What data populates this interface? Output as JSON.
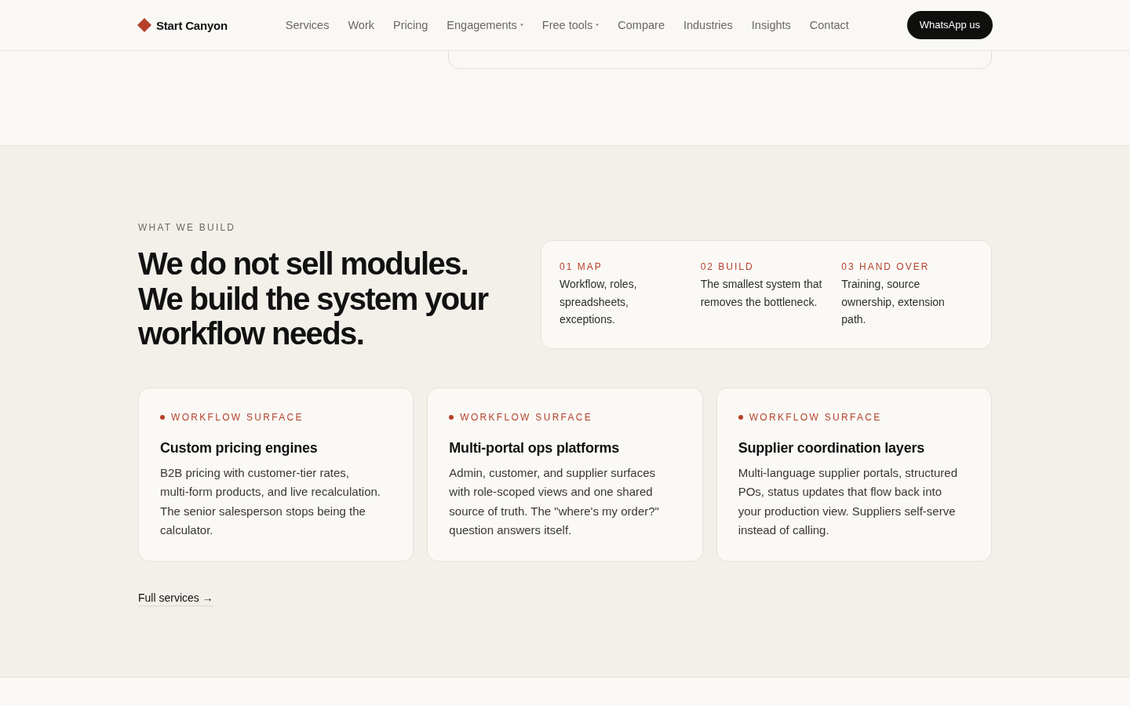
{
  "header": {
    "brand": "Start Canyon",
    "nav": [
      {
        "label": "Services",
        "kind": "link"
      },
      {
        "label": "Work",
        "kind": "link"
      },
      {
        "label": "Pricing",
        "kind": "link"
      },
      {
        "label": "Engagements",
        "kind": "dropdown"
      },
      {
        "label": "Free tools",
        "kind": "dropdown"
      },
      {
        "label": "Compare",
        "kind": "link"
      },
      {
        "label": "Industries",
        "kind": "link"
      },
      {
        "label": "Insights",
        "kind": "link"
      },
      {
        "label": "Contact",
        "kind": "link"
      }
    ],
    "cta": "WhatsApp us"
  },
  "section": {
    "eyebrow": "WHAT WE BUILD",
    "heading": [
      "We do not sell modules.",
      "We build the system your",
      "workflow needs."
    ],
    "steps": [
      {
        "label": "01 MAP",
        "text": "Workflow, roles, spreadsheets, exceptions."
      },
      {
        "label": "02 BUILD",
        "text": "The smallest system that removes the bottleneck."
      },
      {
        "label": "03 HAND OVER",
        "text": "Training, source ownership, extension path."
      }
    ],
    "cards": [
      {
        "tag": "WORKFLOW SURFACE",
        "title": "Custom pricing engines",
        "body": "B2B pricing with customer-tier rates, multi-form products, and live recalculation. The senior salesperson stops being the calculator."
      },
      {
        "tag": "WORKFLOW SURFACE",
        "title": "Multi-portal ops platforms",
        "body": "Admin, customer, and supplier surfaces with role-scoped views and one shared source of truth. The \"where's my order?\" question answers itself."
      },
      {
        "tag": "WORKFLOW SURFACE",
        "title": "Supplier coordination layers",
        "body": "Multi-language supplier portals, structured POs, status updates that flow back into your production view. Suppliers self-serve instead of calling."
      }
    ],
    "link": "Full services →"
  }
}
